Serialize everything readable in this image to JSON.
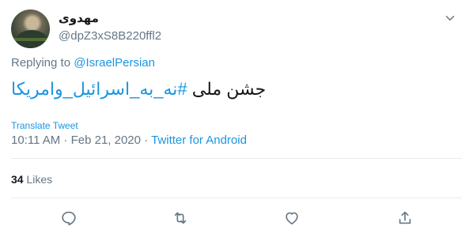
{
  "user": {
    "display_name": "مهدوی",
    "handle": "@dpZ3xS8B220ffl2"
  },
  "reply": {
    "prefix": "Replying to",
    "target": "@IsraelPersian"
  },
  "tweet": {
    "text_plain": "جشن ملی ",
    "hashtag": "#نه_به_اسرائیل_وامریکا"
  },
  "translate_label": "Translate Tweet",
  "meta": {
    "timestamp": "10:11 AM · Feb 21, 2020 · ",
    "source": "Twitter for Android"
  },
  "stats": {
    "likes_count": "34",
    "likes_label": "Likes"
  },
  "icons": {
    "reply": "reply-icon",
    "retweet": "retweet-icon",
    "like": "heart-icon",
    "share": "share-icon",
    "more": "chevron-down-icon"
  },
  "colors": {
    "link": "#1b95e0",
    "secondary": "#657786",
    "text": "#14171a",
    "divider": "#e6ecf0"
  }
}
